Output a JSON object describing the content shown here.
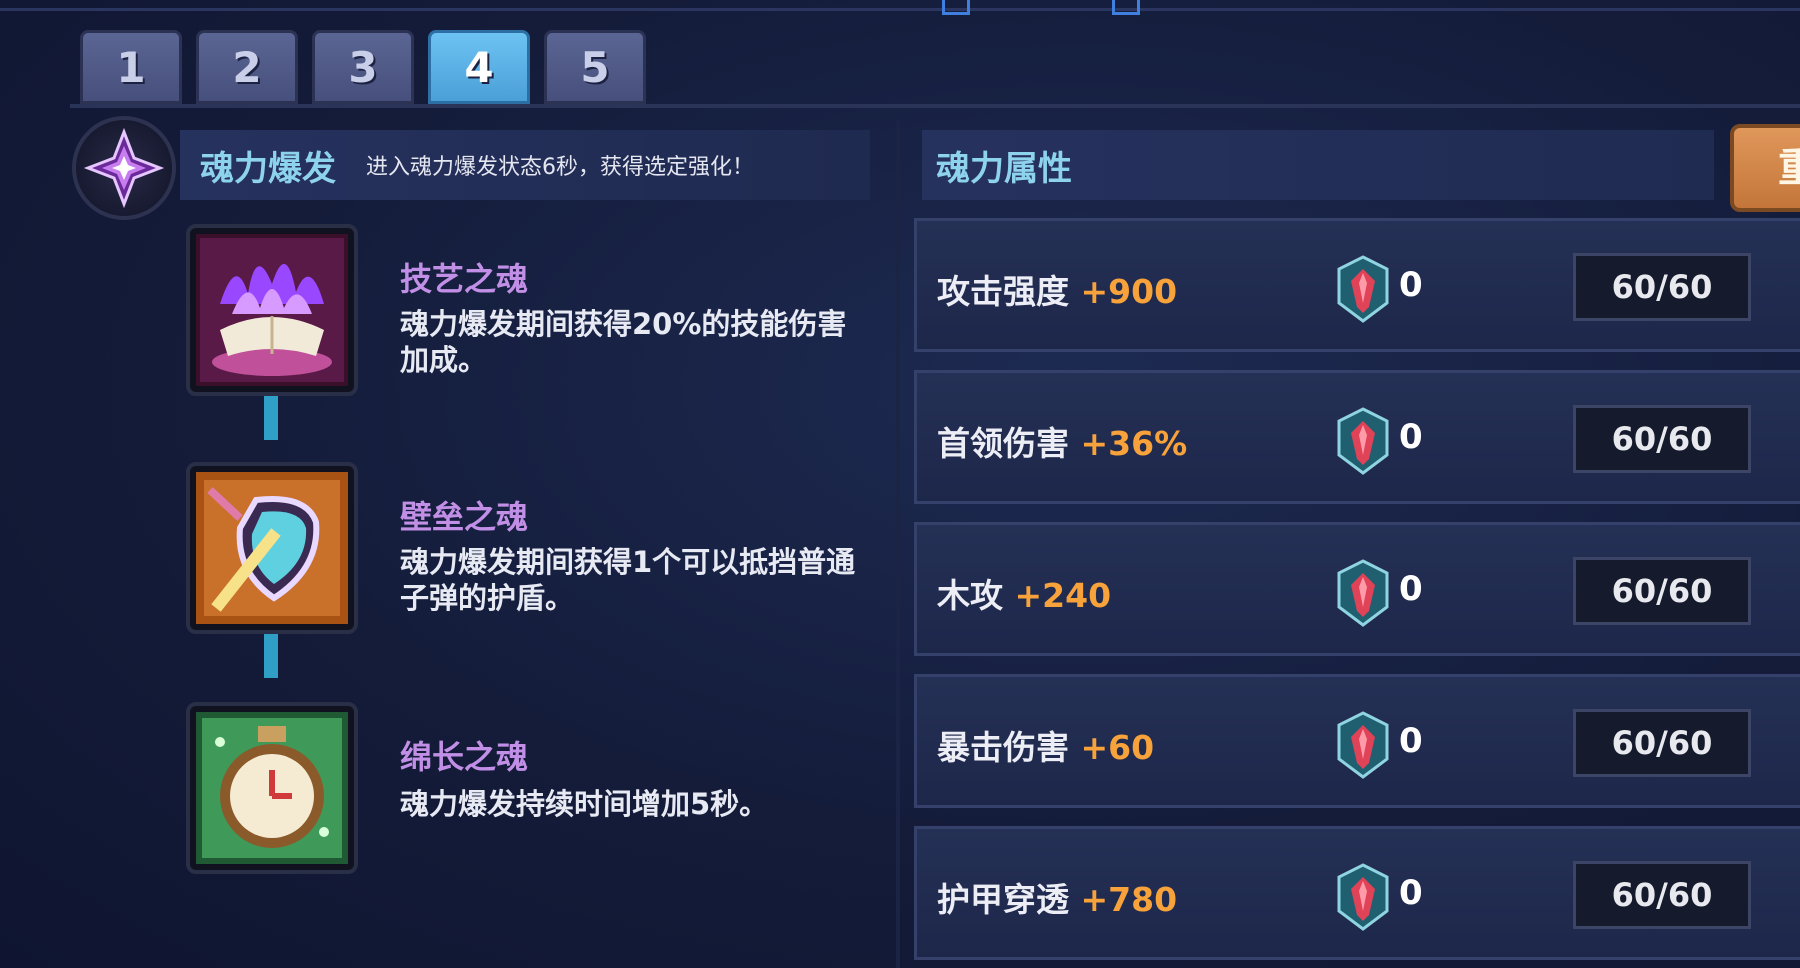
{
  "tabs": [
    {
      "label": "1",
      "active": false
    },
    {
      "label": "2",
      "active": false
    },
    {
      "label": "3",
      "active": false
    },
    {
      "label": "4",
      "active": true
    },
    {
      "label": "5",
      "active": false
    }
  ],
  "burst": {
    "title": "魂力爆发",
    "description": "进入魂力爆发状态6秒，获得选定强化！",
    "icon": "crystal-star-icon"
  },
  "skills": [
    {
      "name": "技艺之魂",
      "description": "魂力爆发期间获得20%的技能伤害加成。",
      "icon": "purple-flame-tome-icon"
    },
    {
      "name": "壁垒之魂",
      "description": "魂力爆发期间获得1个可以抵挡普通子弹的护盾。",
      "icon": "shield-sword-icon"
    },
    {
      "name": "绵长之魂",
      "description": "魂力爆发持续时间增加5秒。",
      "icon": "stopwatch-icon"
    }
  ],
  "attributes": {
    "title": "魂力属性",
    "reset_label": "重",
    "rows": [
      {
        "name": "攻击强度",
        "bonus": "+900",
        "gem_count": "0",
        "level": "60/60"
      },
      {
        "name": "首领伤害",
        "bonus": "+36%",
        "gem_count": "0",
        "level": "60/60"
      },
      {
        "name": "木攻",
        "bonus": "+240",
        "gem_count": "0",
        "level": "60/60"
      },
      {
        "name": "暴击伤害",
        "bonus": "+60",
        "gem_count": "0",
        "level": "60/60"
      },
      {
        "name": "护甲穿透",
        "bonus": "+780",
        "gem_count": "0",
        "level": "60/60"
      }
    ]
  },
  "colors": {
    "accent_blue": "#6cc3f2",
    "bonus_orange": "#f7a23b",
    "skill_name_purple": "#c18fe6",
    "header_cyan": "#8ed3ee"
  }
}
